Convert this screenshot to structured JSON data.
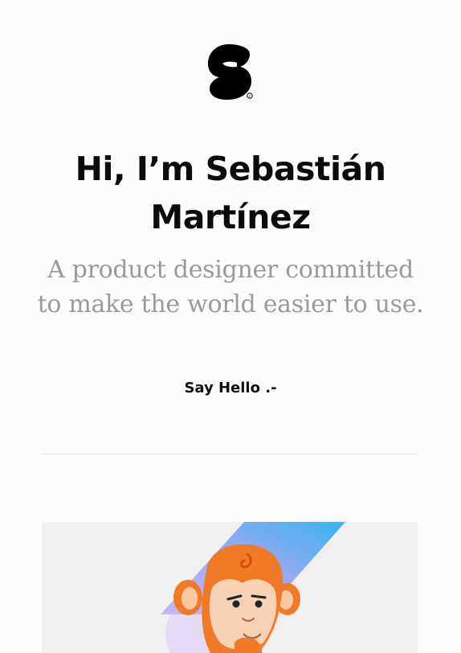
{
  "brand": {
    "logo_icon": "s-monogram-logo",
    "colors": {
      "logo": "#000000"
    }
  },
  "hero": {
    "headline_line1": "Hi, I’m Sebastián",
    "headline_line2": "Martínez",
    "tagline_line1": "A product designer committed",
    "tagline_line2": "to make the world easier to use."
  },
  "cta": {
    "label": "Say Hello .-"
  },
  "illustration": {
    "icon": "monkey-mascot-illustration",
    "colors": {
      "background": "#f0f0f0",
      "monkey": "#f07a28",
      "face": "#f8d2b4",
      "gradient_start": "#b0a0f0",
      "gradient_end": "#40b8f0"
    }
  }
}
